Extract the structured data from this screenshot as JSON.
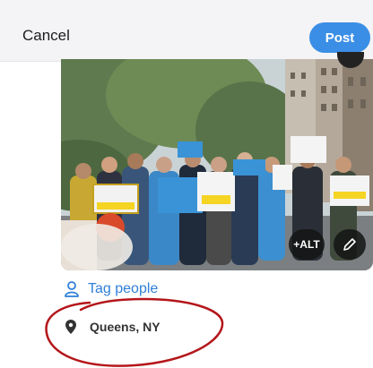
{
  "header": {
    "cancel_label": "Cancel",
    "post_label": "Post"
  },
  "photo": {
    "signs": [
      "#JUSTPAY",
      "UP ALL NIGHT FOR #JUSTPAY"
    ],
    "alt_label": "+ALT",
    "edit_icon": "pencil-icon"
  },
  "tag": {
    "label": "Tag people",
    "icon": "person-icon"
  },
  "location": {
    "label": "Queens, NY",
    "icon": "location-pin-icon"
  },
  "colors": {
    "accent": "#3b8ee6",
    "link": "#2f7fd8",
    "scribble": "#b4161a"
  }
}
